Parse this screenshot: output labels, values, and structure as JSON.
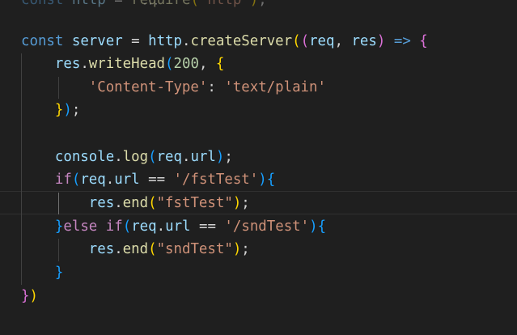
{
  "editor": {
    "lines": [
      {
        "tokens": [
          [
            "kw",
            "const"
          ],
          [
            "op",
            " "
          ],
          [
            "var",
            "http"
          ],
          [
            "op",
            " = "
          ],
          [
            "fn",
            "require"
          ],
          [
            "b1",
            "("
          ],
          [
            "str",
            "'http'"
          ],
          [
            "b1",
            ")"
          ],
          [
            "op",
            ";"
          ]
        ]
      },
      {
        "tokens": []
      },
      {
        "tokens": [
          [
            "kw",
            "const"
          ],
          [
            "op",
            " "
          ],
          [
            "var",
            "server"
          ],
          [
            "op",
            " = "
          ],
          [
            "var",
            "http"
          ],
          [
            "op",
            "."
          ],
          [
            "fn",
            "createServer"
          ],
          [
            "b1",
            "("
          ],
          [
            "b2",
            "("
          ],
          [
            "var",
            "req"
          ],
          [
            "op",
            ", "
          ],
          [
            "var",
            "res"
          ],
          [
            "b2",
            ")"
          ],
          [
            "op",
            " "
          ],
          [
            "kw",
            "=>"
          ],
          [
            "op",
            " "
          ],
          [
            "b2",
            "{"
          ]
        ]
      },
      {
        "tokens": [
          [
            "op",
            "    "
          ],
          [
            "var",
            "res"
          ],
          [
            "op",
            "."
          ],
          [
            "fn",
            "writeHead"
          ],
          [
            "b3",
            "("
          ],
          [
            "num",
            "200"
          ],
          [
            "op",
            ", "
          ],
          [
            "b1",
            "{"
          ]
        ]
      },
      {
        "tokens": [
          [
            "op",
            "        "
          ],
          [
            "str",
            "'Content-Type'"
          ],
          [
            "op",
            ": "
          ],
          [
            "str",
            "'text/plain'"
          ]
        ]
      },
      {
        "tokens": [
          [
            "op",
            "    "
          ],
          [
            "b1",
            "}"
          ],
          [
            "b3",
            ")"
          ],
          [
            "op",
            ";"
          ]
        ]
      },
      {
        "tokens": []
      },
      {
        "tokens": [
          [
            "op",
            "    "
          ],
          [
            "var",
            "console"
          ],
          [
            "op",
            "."
          ],
          [
            "fn",
            "log"
          ],
          [
            "b3",
            "("
          ],
          [
            "var",
            "req"
          ],
          [
            "op",
            "."
          ],
          [
            "var",
            "url"
          ],
          [
            "b3",
            ")"
          ],
          [
            "op",
            ";"
          ]
        ]
      },
      {
        "tokens": [
          [
            "op",
            "    "
          ],
          [
            "ctl",
            "if"
          ],
          [
            "b3",
            "("
          ],
          [
            "var",
            "req"
          ],
          [
            "op",
            "."
          ],
          [
            "var",
            "url"
          ],
          [
            "op",
            " == "
          ],
          [
            "str",
            "'/fstTest'"
          ],
          [
            "b3",
            ")"
          ],
          [
            "b3",
            "{"
          ]
        ]
      },
      {
        "tokens": [
          [
            "op",
            "        "
          ],
          [
            "var",
            "res"
          ],
          [
            "op",
            "."
          ],
          [
            "fn",
            "end"
          ],
          [
            "b1",
            "("
          ],
          [
            "str",
            "\"fstTest\""
          ],
          [
            "b1",
            ")"
          ],
          [
            "op",
            ";"
          ]
        ]
      },
      {
        "tokens": [
          [
            "op",
            "    "
          ],
          [
            "b3",
            "}"
          ],
          [
            "ctl",
            "else"
          ],
          [
            "op",
            " "
          ],
          [
            "ctl",
            "if"
          ],
          [
            "b3",
            "("
          ],
          [
            "var",
            "req"
          ],
          [
            "op",
            "."
          ],
          [
            "var",
            "url"
          ],
          [
            "op",
            " == "
          ],
          [
            "str",
            "'/sndTest'"
          ],
          [
            "b3",
            ")"
          ],
          [
            "b3",
            "{"
          ]
        ]
      },
      {
        "tokens": [
          [
            "op",
            "        "
          ],
          [
            "var",
            "res"
          ],
          [
            "op",
            "."
          ],
          [
            "fn",
            "end"
          ],
          [
            "b1",
            "("
          ],
          [
            "str",
            "\"sndTest\""
          ],
          [
            "b1",
            ")"
          ],
          [
            "op",
            ";"
          ]
        ]
      },
      {
        "tokens": [
          [
            "op",
            "    "
          ],
          [
            "b3",
            "}"
          ]
        ]
      },
      {
        "tokens": [
          [
            "b2",
            "}"
          ],
          [
            "b1",
            ")"
          ]
        ]
      },
      {
        "tokens": []
      }
    ]
  }
}
